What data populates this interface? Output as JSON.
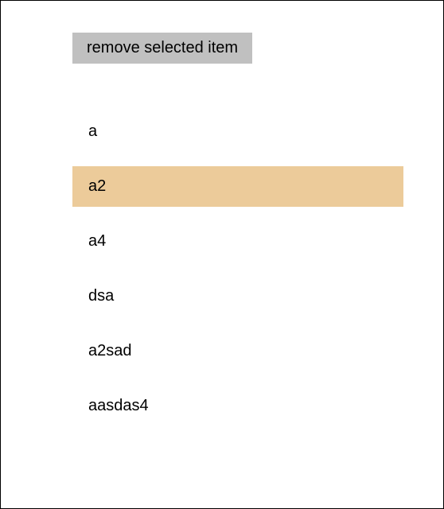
{
  "button": {
    "remove_label": "remove selected item"
  },
  "list": {
    "items": [
      {
        "label": "a",
        "selected": false
      },
      {
        "label": "a2",
        "selected": true
      },
      {
        "label": "a4",
        "selected": false
      },
      {
        "label": "dsa",
        "selected": false
      },
      {
        "label": "a2sad",
        "selected": false
      },
      {
        "label": "aasdas4",
        "selected": false
      }
    ]
  },
  "colors": {
    "button_bg": "#c0c0c0",
    "selected_bg": "#eccb9a"
  }
}
